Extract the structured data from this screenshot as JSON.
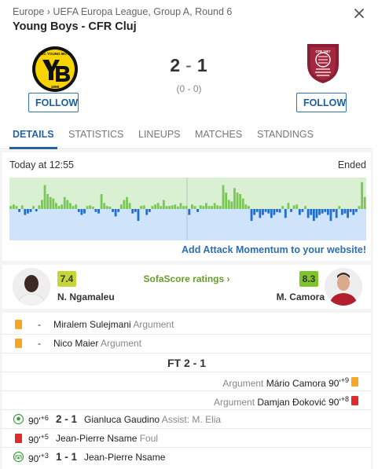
{
  "header": {
    "breadcrumb": "Europe › UEFA Europa League, Group A, Round 6",
    "title": "Young Boys - CFR Cluj"
  },
  "match": {
    "home_score": "2",
    "separator": "-",
    "away_score": "1",
    "halftime": "(0 - 0)",
    "home_follow": "FOLLOW",
    "away_follow": "FOLLOW",
    "home_logo_text": "BSC YOUNG BOYS",
    "home_logo_year": "1898",
    "away_logo_text": "CFR 1907"
  },
  "tabs": [
    {
      "label": "DETAILS",
      "active": true
    },
    {
      "label": "STATISTICS"
    },
    {
      "label": "LINEUPS"
    },
    {
      "label": "MATCHES"
    },
    {
      "label": "STANDINGS"
    }
  ],
  "status": {
    "time": "Today at 12:55",
    "state": "Ended",
    "add_link": "Add Attack Momentum to your website!"
  },
  "momentum": {
    "home_color": "#7bc659",
    "away_color": "#1f6fd0",
    "values": [
      0.1,
      0.15,
      0.1,
      -0.1,
      0.12,
      -0.2,
      -0.15,
      -0.1,
      0.1,
      -0.08,
      0.12,
      0.3,
      0.8,
      0.5,
      0.4,
      0.35,
      0.2,
      0.1,
      0.15,
      0.4,
      0.3,
      0.2,
      0.1,
      0.15,
      -0.1,
      -0.2,
      -0.15,
      0.1,
      0.12,
      0.08,
      -0.1,
      -0.15,
      0.5,
      0.2,
      0.1,
      0.08,
      -0.1,
      -0.25,
      -0.1,
      0.15,
      0.3,
      0.4,
      0.2,
      -0.15,
      -0.1,
      -0.4,
      0.1,
      0.12,
      -0.2,
      -0.1,
      0.1,
      0.15,
      0.2,
      0.1,
      0.3,
      0.1,
      0.1,
      0.12,
      0.15,
      0.08,
      0.2,
      0.1,
      0.1,
      -0.2,
      0.15,
      0.1,
      -0.1,
      0.12,
      0.1,
      0.2,
      0.1,
      0.1,
      0.2,
      0.12,
      0.1,
      0.8,
      0.55,
      0.3,
      0.25,
      0.7,
      0.55,
      0.5,
      0.35,
      0.15,
      0.1,
      -0.4,
      -0.2,
      -0.1,
      -0.3,
      -0.2,
      -0.1,
      -0.15,
      -0.3,
      -0.2,
      -0.1,
      -0.12,
      0.1,
      -0.3,
      0.2,
      -0.1,
      0.12,
      0.15,
      -0.2,
      -0.1,
      0.1,
      -0.3,
      -0.2,
      -0.4,
      -0.3,
      -0.2,
      -0.15,
      -0.1,
      -0.2,
      -0.4,
      -0.1,
      -0.3,
      0.1,
      -0.2,
      -0.15,
      -0.3,
      -0.1,
      -0.2,
      -0.1,
      0.1,
      0.9,
      0.4
    ]
  },
  "ratings": {
    "home_rating": "7.4",
    "away_rating": "8.3",
    "link": "SofaScore ratings ›",
    "home_player": "N. Ngamaleu",
    "away_player": "M. Camora"
  },
  "events_top": [
    {
      "minute": "-",
      "player": "Miralem Sulejmani",
      "reason": "Argument",
      "card": "yellow"
    },
    {
      "minute": "-",
      "player": "Nico Maier",
      "reason": "Argument",
      "card": "yellow"
    }
  ],
  "fulltime": "FT 2 - 1",
  "events_away": [
    {
      "reason": "Argument",
      "player": "Mário Camora",
      "minute": "90'",
      "added": "+9",
      "card": "yellow"
    },
    {
      "reason": "Argument",
      "player": "Damjan Đoković",
      "minute": "90'",
      "added": "+8",
      "card": "red"
    }
  ],
  "events_home": [
    {
      "minute": "90'",
      "added": "+6",
      "score": "2 - 1",
      "player": "Gianluca Gaudino",
      "assist": "Assist: M. Elia",
      "type": "goal"
    },
    {
      "minute": "90'",
      "added": "+5",
      "player": "Jean-Pierre Nsame",
      "reason": "Foul",
      "type": "red"
    },
    {
      "minute": "90'",
      "added": "+3",
      "score": "1 - 1",
      "player": "Jean-Pierre Nsame",
      "type": "penalty-goal"
    }
  ]
}
